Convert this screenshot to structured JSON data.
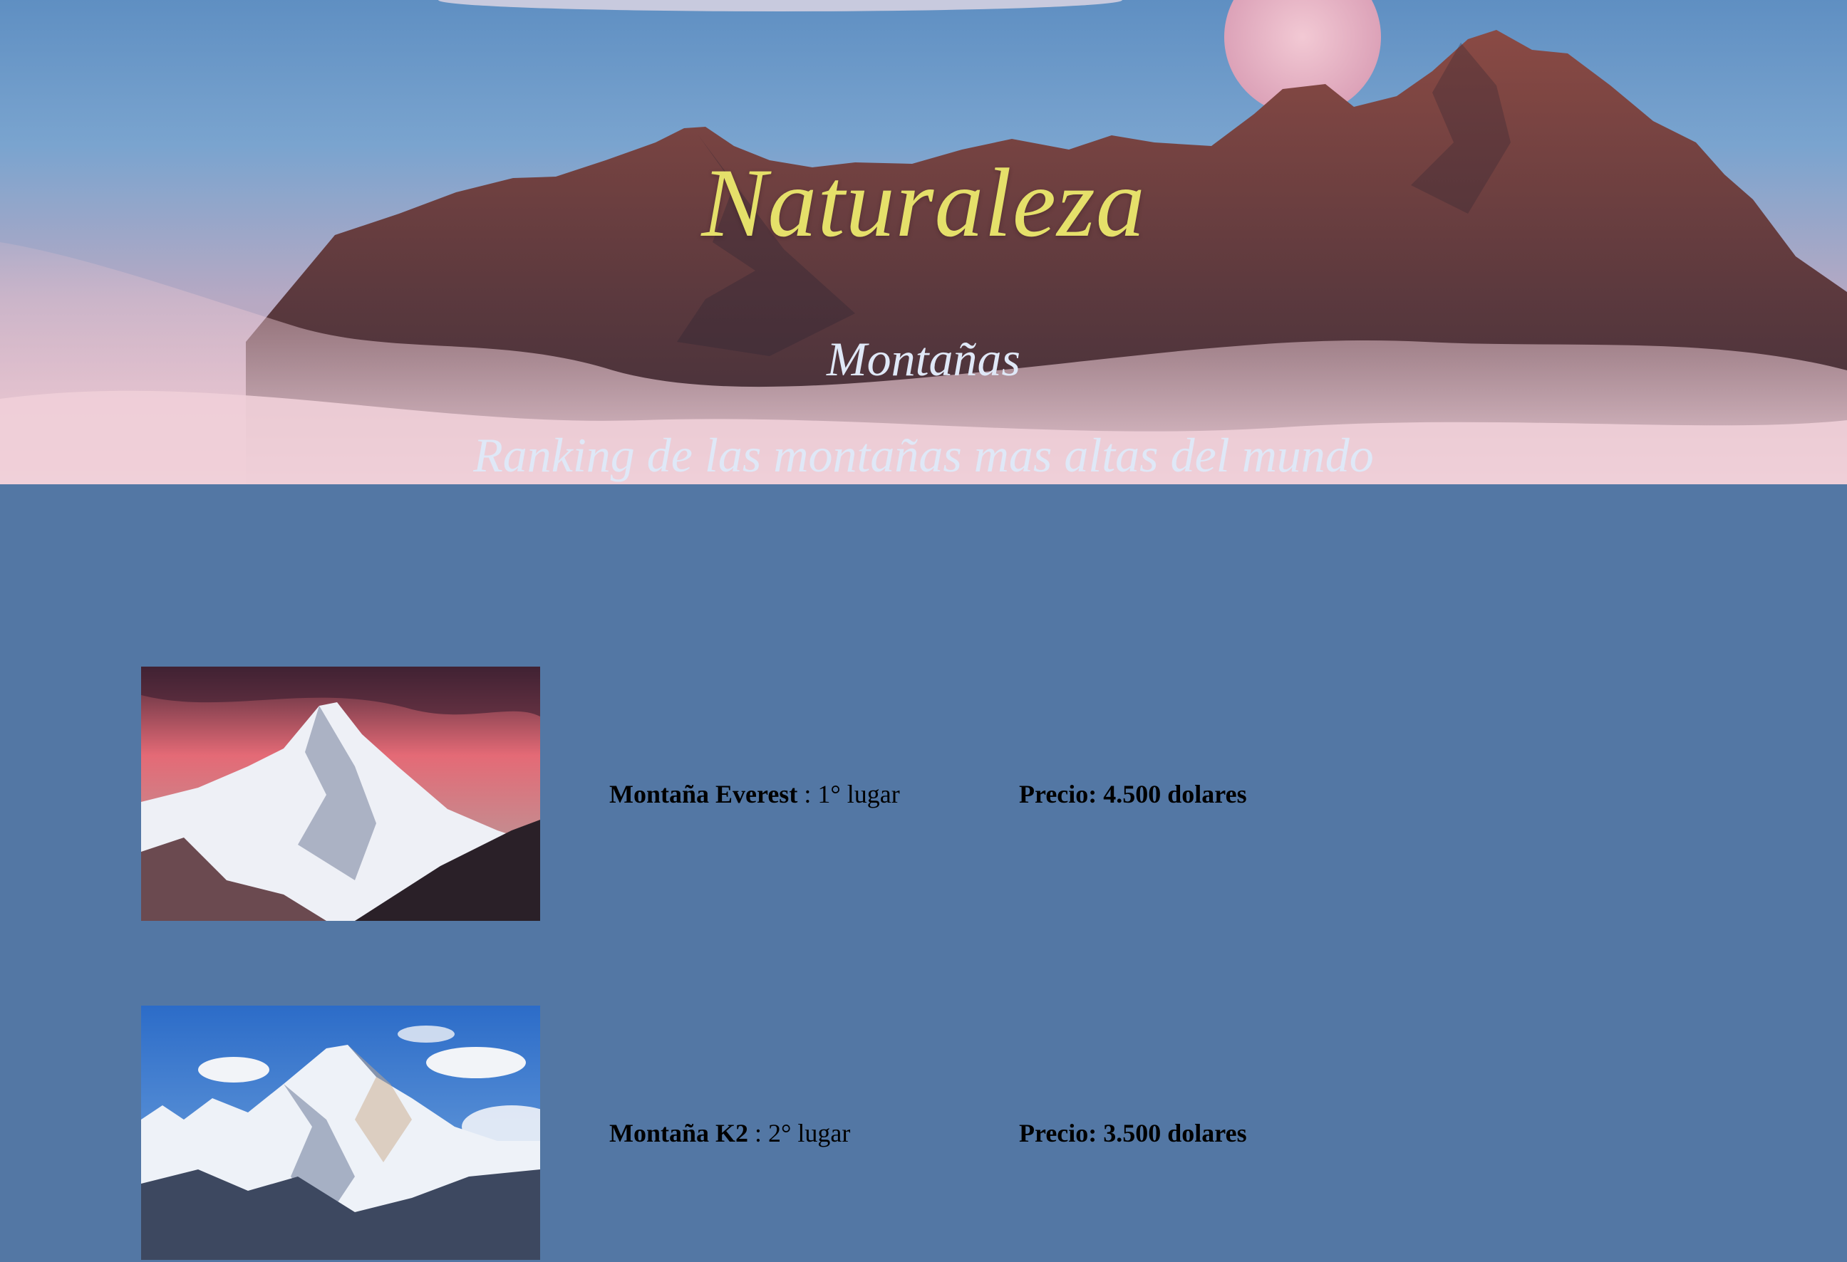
{
  "header": {
    "title": "Naturaleza",
    "subtitle": "Montañas",
    "tagline": "Ranking de las montañas mas altas del mundo"
  },
  "colors": {
    "page_background": "#5377a4",
    "title": "#e5e06a",
    "subtitle": "#dfe8f7"
  },
  "mountains": [
    {
      "name": "Montaña Everest",
      "rank": " : 1° lugar",
      "price": "Precio: 4.500 dolares"
    },
    {
      "name": "Montaña K2",
      "rank": " : 2° lugar",
      "price": "Precio: 3.500 dolares"
    }
  ]
}
